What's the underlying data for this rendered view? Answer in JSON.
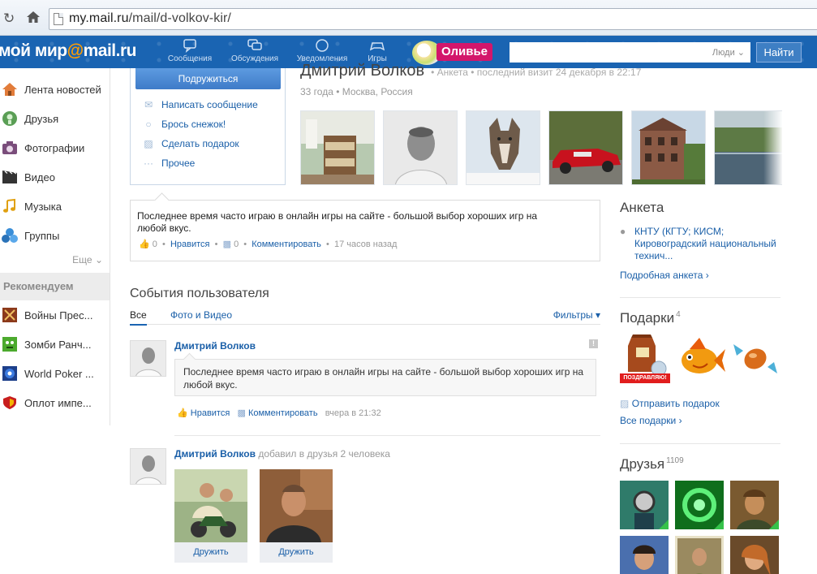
{
  "browser": {
    "url_domain": "my.mail.ru",
    "url_path": "/mail/d-volkov-kir/"
  },
  "header": {
    "logo_main": "мой мир",
    "logo_at": "@",
    "logo_domain": "mail.ru",
    "nav": [
      {
        "label": "Сообщения",
        "icon": "message-icon"
      },
      {
        "label": "Обсуждения",
        "icon": "discussion-icon"
      },
      {
        "label": "Уведомления",
        "icon": "notification-icon"
      },
      {
        "label": "Игры",
        "icon": "gamepad-icon"
      }
    ],
    "promo_label": "Оливье",
    "search_scope": "Люди",
    "search_button": "Найти",
    "search_value": ""
  },
  "sidebar": {
    "items": [
      {
        "label": "Лента новостей",
        "icon": "house-icon"
      },
      {
        "label": "Друзья",
        "icon": "friends-icon"
      },
      {
        "label": "Фотографии",
        "icon": "camera-icon"
      },
      {
        "label": "Видео",
        "icon": "film-icon"
      },
      {
        "label": "Музыка",
        "icon": "music-note-icon"
      },
      {
        "label": "Группы",
        "icon": "groups-icon"
      }
    ],
    "more": "Еще",
    "recommend_header": "Рекомендуем",
    "recommended": [
      {
        "label": "Войны Прес...",
        "icon": "swords-icon"
      },
      {
        "label": "Зомби Ранч...",
        "icon": "zombie-icon"
      },
      {
        "label": "World Poker ...",
        "icon": "poker-icon"
      },
      {
        "label": "Оплот импе...",
        "icon": "shield-icon"
      }
    ]
  },
  "profile": {
    "add_friend_button": "Подружиться",
    "actions": [
      {
        "label": "Написать сообщение",
        "icon": "envelope-icon"
      },
      {
        "label": "Брось снежок!",
        "icon": "snowball-icon"
      },
      {
        "label": "Сделать подарок",
        "icon": "gift-icon"
      },
      {
        "label": "Прочее",
        "icon": "dots-icon"
      }
    ],
    "name": "Дмитрий Волков",
    "name_meta": "• Анкета • последний визит 24 декабря в 22:17",
    "info": "33 года • Москва, Россия"
  },
  "status": {
    "text": "Последнее время часто играю в онлайн игры на сайте -   большой выбор хороших игр на любой вкус.",
    "likes": "0",
    "like_label": "Нравится",
    "comments": "0",
    "comment_label": "Комментировать",
    "time": "17 часов назад"
  },
  "events": {
    "title": "События пользователя",
    "tab_all": "Все",
    "tab_photo": "Фото и Видео",
    "filters": "Фильтры",
    "post1": {
      "author": "Дмитрий Волков",
      "text": "Последнее время часто играю в онлайн игры на сайте -   большой выбор хороших игр на любой вкус.",
      "like_label": "Нравится",
      "comment_label": "Комментировать",
      "time": "вчера в 21:32",
      "report": "!"
    },
    "post2": {
      "author": "Дмитрий Волков",
      "action": "добавил в друзья 2 человека",
      "befriend": "Дружить"
    }
  },
  "right": {
    "anketa_title": "Анкета",
    "edu": "КНТУ (КГТУ; КИСМ; Кировоградский национальный технич...",
    "anketa_link": "Подробная анкета",
    "gifts_title": "Подарки",
    "gifts_count": "4",
    "gift_caption": "ПОЗДРАВЛЯЮ!",
    "send_gift": "Отправить подарок",
    "all_gifts": "Все подарки",
    "friends_title": "Друзья",
    "friends_count": "1109"
  },
  "colors": {
    "header_blue": "#1a64b2",
    "link_blue": "#1a5fa8",
    "promo_pink": "#d3166b",
    "logo_orange": "#ff9c00"
  }
}
